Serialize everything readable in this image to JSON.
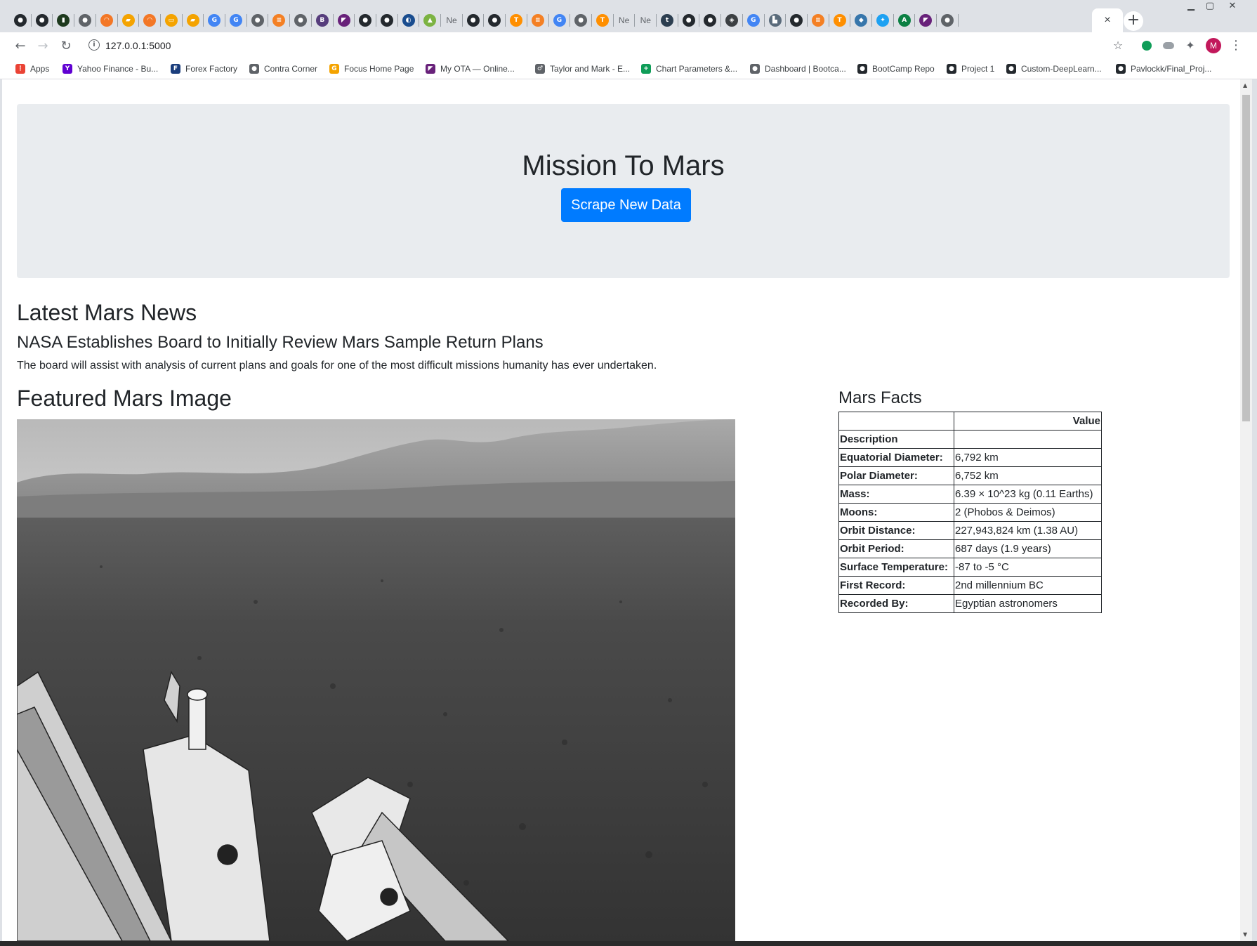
{
  "browser": {
    "tabs": [
      {
        "icon": "github-icon",
        "color": "#24292e",
        "glyph": "●"
      },
      {
        "icon": "github-icon",
        "color": "#24292e",
        "glyph": "●"
      },
      {
        "icon": "terminal-icon",
        "color": "#1e3a1e",
        "glyph": "▮"
      },
      {
        "icon": "globe-icon",
        "color": "#5f6368",
        "glyph": "●"
      },
      {
        "icon": "jupyter-icon",
        "color": "#f37726",
        "glyph": "◠"
      },
      {
        "icon": "notes-icon",
        "color": "#f4a300",
        "glyph": "▰"
      },
      {
        "icon": "jupyter-icon",
        "color": "#f37726",
        "glyph": "◠"
      },
      {
        "icon": "document-icon",
        "color": "#f4a300",
        "glyph": "▭"
      },
      {
        "icon": "notes-icon",
        "color": "#f4a300",
        "glyph": "▰"
      },
      {
        "icon": "google-icon",
        "color": "#4285f4",
        "glyph": "G"
      },
      {
        "icon": "google-icon",
        "color": "#4285f4",
        "glyph": "G"
      },
      {
        "icon": "globe-icon",
        "color": "#5f6368",
        "glyph": "●"
      },
      {
        "icon": "stackoverflow-icon",
        "color": "#f48024",
        "glyph": "≡"
      },
      {
        "icon": "globe-icon",
        "color": "#5f6368",
        "glyph": "●"
      },
      {
        "icon": "bootstrap-icon",
        "color": "#563d7c",
        "glyph": "B"
      },
      {
        "icon": "visual-studio-icon",
        "color": "#68217a",
        "glyph": "◤"
      },
      {
        "icon": "github-icon",
        "color": "#24292e",
        "glyph": "●"
      },
      {
        "icon": "github-icon",
        "color": "#24292e",
        "glyph": "●"
      },
      {
        "icon": "moon-icon",
        "color": "#1a4d8f",
        "glyph": "◐"
      },
      {
        "icon": "chart-icon",
        "color": "#7cb342",
        "glyph": "▲"
      },
      {
        "icon": "new-tab-text",
        "color": "#5f6368",
        "glyph": "Ne"
      },
      {
        "icon": "github-icon",
        "color": "#24292e",
        "glyph": "●"
      },
      {
        "icon": "github-icon",
        "color": "#24292e",
        "glyph": "●"
      },
      {
        "icon": "tensorflow-icon",
        "color": "#ff8f00",
        "glyph": "T"
      },
      {
        "icon": "stackoverflow-icon",
        "color": "#f48024",
        "glyph": "≡"
      },
      {
        "icon": "google-icon",
        "color": "#4285f4",
        "glyph": "G"
      },
      {
        "icon": "globe-icon",
        "color": "#5f6368",
        "glyph": "●"
      },
      {
        "icon": "tensorflow-icon",
        "color": "#ff8f00",
        "glyph": "T"
      },
      {
        "icon": "new-tab-text",
        "color": "#5f6368",
        "glyph": "Ne"
      },
      {
        "icon": "new-tab-text",
        "color": "#5f6368",
        "glyph": "Ne"
      },
      {
        "icon": "tds-icon",
        "color": "#2c3e50",
        "glyph": "t"
      },
      {
        "icon": "github-icon",
        "color": "#24292e",
        "glyph": "●"
      },
      {
        "icon": "github-icon",
        "color": "#24292e",
        "glyph": "●"
      },
      {
        "icon": "diamond-icon",
        "color": "#3c4043",
        "glyph": "◈"
      },
      {
        "icon": "google-icon",
        "color": "#4285f4",
        "glyph": "G"
      },
      {
        "icon": "castle-icon",
        "color": "#5a6b7b",
        "glyph": "▙"
      },
      {
        "icon": "github-icon",
        "color": "#24292e",
        "glyph": "●"
      },
      {
        "icon": "stackoverflow-icon",
        "color": "#f48024",
        "glyph": "≡"
      },
      {
        "icon": "tensorflow-icon",
        "color": "#ff8f00",
        "glyph": "T"
      },
      {
        "icon": "python-icon",
        "color": "#3776ab",
        "glyph": "◆"
      },
      {
        "icon": "twitter-icon",
        "color": "#1da1f2",
        "glyph": "✦"
      },
      {
        "icon": "app-icon",
        "color": "#0b8043",
        "glyph": "A"
      },
      {
        "icon": "visual-studio-icon",
        "color": "#68217a",
        "glyph": "◤"
      },
      {
        "icon": "apple-icon",
        "color": "#5f6368",
        "glyph": "●"
      }
    ],
    "active_tab_close": "×",
    "new_tab": "+",
    "window_controls": [
      "▁",
      "▢",
      "✕"
    ],
    "back": "←",
    "forward": "→",
    "reload": "↻",
    "url_info": "i",
    "url": "127.0.0.1:5000",
    "star": "☆",
    "extension_glyph": "✦",
    "avatar_initial": "M",
    "menu": "⋮",
    "bookmarks": [
      {
        "label": "Apps",
        "icon": "apps-grid-icon",
        "color": "#ea4335",
        "glyph": "⋮"
      },
      {
        "label": "Yahoo Finance - Bu...",
        "icon": "yahoo-icon",
        "color": "#6001d2",
        "glyph": "Y"
      },
      {
        "label": "Forex Factory",
        "icon": "forex-factory-icon",
        "color": "#1a3d7c",
        "glyph": "F"
      },
      {
        "label": "Contra Corner",
        "icon": "globe-icon",
        "color": "#5f6368",
        "glyph": "●"
      },
      {
        "label": "Focus Home Page",
        "icon": "focus-icon",
        "color": "#f4a300",
        "glyph": "G"
      },
      {
        "label": "My OTA — Online...",
        "icon": "visual-studio-icon",
        "color": "#68217a",
        "glyph": "◤"
      },
      {
        "label": "Taylor and Mark - E...",
        "icon": "mars-symbol-icon",
        "color": "#5f6368",
        "glyph": "♂"
      },
      {
        "label": "Chart Parameters &...",
        "icon": "sheets-icon",
        "color": "#0f9d58",
        "glyph": "+"
      },
      {
        "label": "Dashboard | Bootca...",
        "icon": "globe-icon",
        "color": "#5f6368",
        "glyph": "●"
      },
      {
        "label": "BootCamp Repo",
        "icon": "github-icon",
        "color": "#24292e",
        "glyph": "●"
      },
      {
        "label": "Project 1",
        "icon": "github-icon",
        "color": "#24292e",
        "glyph": "●"
      },
      {
        "label": "Custom-DeepLearn...",
        "icon": "github-icon",
        "color": "#24292e",
        "glyph": "●"
      },
      {
        "label": "Pavlockk/Final_Proj...",
        "icon": "github-icon",
        "color": "#24292e",
        "glyph": "●"
      }
    ]
  },
  "page": {
    "title": "Mission To Mars",
    "scrape_button": "Scrape New Data",
    "news_heading": "Latest Mars News",
    "news_title": "NASA Establishes Board to Initially Review Mars Sample Return Plans",
    "news_teaser": "The board will assist with analysis of current plans and goals for one of the most difficult missions humanity has ever undertaken.",
    "image_heading": "Featured Mars Image",
    "facts_heading": "Mars Facts",
    "facts": {
      "column_header": "Value",
      "first_label": "Description",
      "rows": [
        {
          "label": "Equatorial Diameter:",
          "value": "6,792 km"
        },
        {
          "label": "Polar Diameter:",
          "value": "6,752 km"
        },
        {
          "label": "Mass:",
          "value": "6.39 × 10^23 kg (0.11 Earths)"
        },
        {
          "label": "Moons:",
          "value": "2 (Phobos & Deimos)"
        },
        {
          "label": "Orbit Distance:",
          "value": "227,943,824 km (1.38 AU)"
        },
        {
          "label": "Orbit Period:",
          "value": "687 days (1.9 years)"
        },
        {
          "label": "Surface Temperature:",
          "value": "-87 to -5 °C"
        },
        {
          "label": "First Record:",
          "value": "2nd millennium BC"
        },
        {
          "label": "Recorded By:",
          "value": "Egyptian astronomers"
        }
      ]
    }
  },
  "colors": {
    "primary_button": "#007bff",
    "jumbotron": "#e9ecef",
    "chrome_frame": "#dee1e6"
  }
}
